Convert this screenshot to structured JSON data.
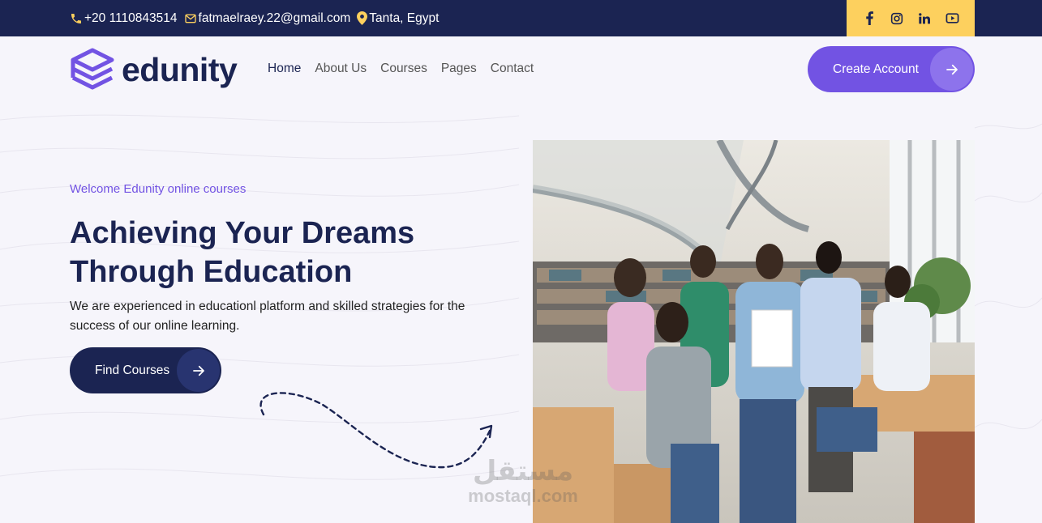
{
  "topbar": {
    "phone": "+20 1110843514",
    "email": "fatmaelraey.22@gmail.com",
    "location": "Tanta, Egypt",
    "social": [
      "facebook-icon",
      "instagram-icon",
      "linkedin-icon",
      "youtube-icon"
    ]
  },
  "brand": {
    "name": "edunity"
  },
  "nav": {
    "items": [
      "Home",
      "About Us",
      "Courses",
      "Pages",
      "Contact"
    ],
    "active": "Home"
  },
  "create_account": {
    "label": "Create Account"
  },
  "hero": {
    "subtitle": "Welcome Edunity online courses",
    "title_line1": "Achieving Your Dreams",
    "title_line2": "Through Education",
    "description": "We are experienced in educationl platform and skilled strategies for the success of our online learning.",
    "cta_label": "Find Courses"
  },
  "watermark": {
    "arabic": "مستقل",
    "latin": "mostaql.com"
  },
  "colors": {
    "navy": "#1b2452",
    "purple": "#7253e3",
    "yellow": "#fdd05e",
    "background": "#f6f5fb"
  }
}
